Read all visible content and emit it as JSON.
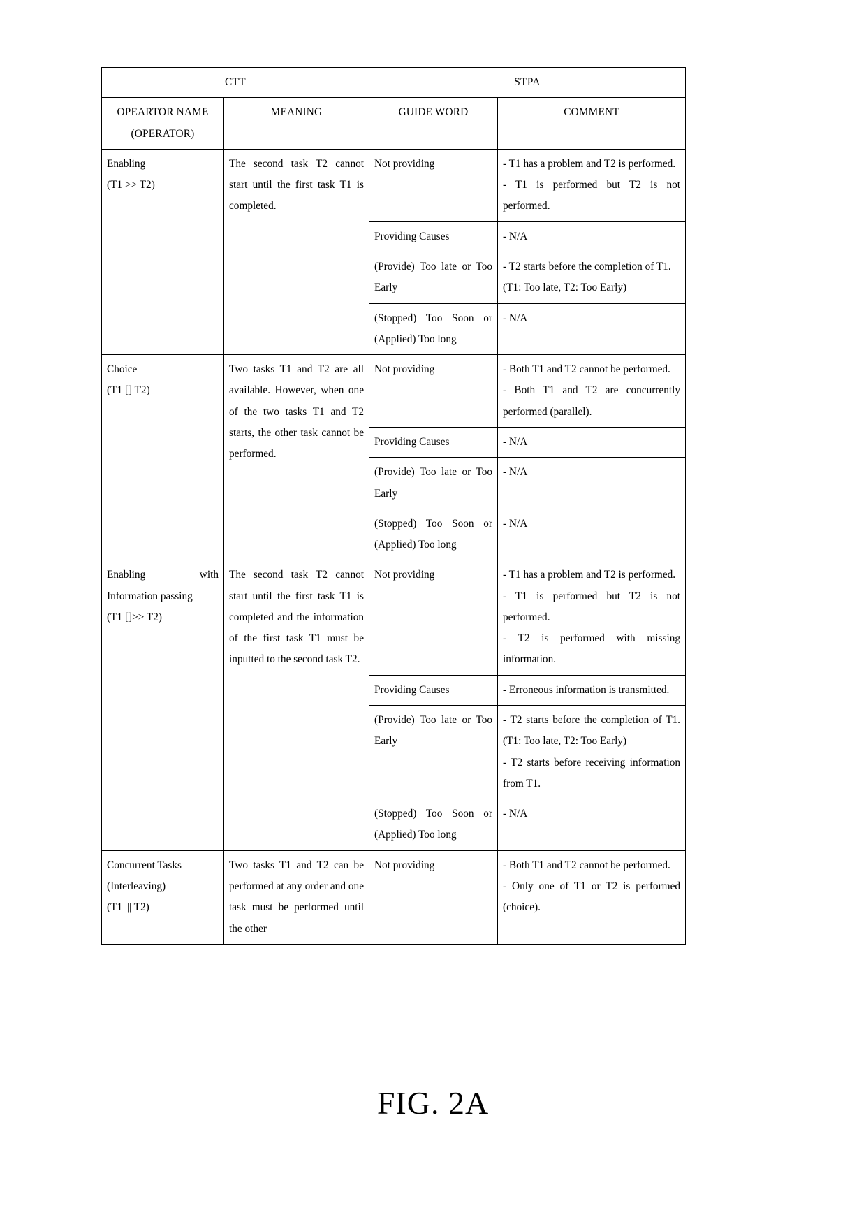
{
  "figure": {
    "caption": "FIG. 2A"
  },
  "table": {
    "group_headers": {
      "ctt": "CTT",
      "stpa": "STPA"
    },
    "column_headers": {
      "operator_name": "OPEARTOR NAME",
      "operator_name_2": "(OPERATOR)",
      "meaning": "MEANING",
      "guide_word": "GUIDE WORD",
      "comment": "COMMENT"
    },
    "rows": [
      {
        "operator": {
          "name": "Enabling",
          "notation": "(T1 >> T2)"
        },
        "meaning": "The second task T2 cannot start until the first task T1 is completed.",
        "entries": [
          {
            "guide_word": "Not providing",
            "comments": [
              "- T1 has a problem and T2 is performed.",
              "- T1 is performed but T2 is not performed."
            ]
          },
          {
            "guide_word": "Providing Causes",
            "comments": [
              "- N/A"
            ]
          },
          {
            "guide_word": "(Provide) Too late or Too Early",
            "comments": [
              "- T2 starts before the completion of T1. (T1: Too late, T2: Too Early)"
            ]
          },
          {
            "guide_word": "(Stopped) Too Soon or (Applied) Too long",
            "comments": [
              "- N/A"
            ]
          }
        ]
      },
      {
        "operator": {
          "name": "Choice",
          "notation": "(T1 [] T2)"
        },
        "meaning": "Two tasks T1 and T2 are all available.  However, when one of the two tasks T1 and T2 starts, the other task cannot be performed.",
        "entries": [
          {
            "guide_word": "Not providing",
            "comments": [
              "- Both T1 and T2 cannot be performed.",
              "- Both T1 and T2 are concurrently performed (parallel)."
            ]
          },
          {
            "guide_word": "Providing Causes",
            "comments": [
              "- N/A"
            ]
          },
          {
            "guide_word": "(Provide) Too late or Too Early",
            "comments": [
              "- N/A"
            ]
          },
          {
            "guide_word": "(Stopped) Too Soon or (Applied) Too long",
            "comments": [
              "- N/A"
            ]
          }
        ]
      },
      {
        "operator": {
          "name": "Enabling with Information passing",
          "notation": "(T1 []>> T2)"
        },
        "meaning": "The second task T2 cannot start until the first task T1 is completed and the information of the first task T1 must be inputted to the second task T2.",
        "entries": [
          {
            "guide_word": "Not providing",
            "comments": [
              "- T1 has a problem and T2 is performed.",
              "- T1 is performed but T2 is not performed.",
              "- T2 is performed with missing information."
            ]
          },
          {
            "guide_word": "Providing Causes",
            "comments": [
              "-    Erroneous    information    is transmitted."
            ]
          },
          {
            "guide_word": "(Provide) Too late or Too Early",
            "comments": [
              "- T2 starts before the completion of T1. (T1: Too late, T2: Too Early)",
              "-   T2   starts   before   receiving information from T1."
            ]
          },
          {
            "guide_word": "(Stopped) Too Soon or (Applied) Too long",
            "comments": [
              "- N/A"
            ]
          }
        ]
      },
      {
        "operator": {
          "name": "Concurrent Tasks",
          "name_2": "(Interleaving)",
          "notation": "(T1 ||| T2)"
        },
        "meaning": "Two tasks T1 and T2 can be performed at any order and one task must be performed until the other",
        "entries": [
          {
            "guide_word": "Not providing",
            "comments": [
              "- Both T1 and T2 cannot be performed.",
              "- Only one of T1 or T2 is performed (choice)."
            ]
          }
        ]
      }
    ]
  }
}
